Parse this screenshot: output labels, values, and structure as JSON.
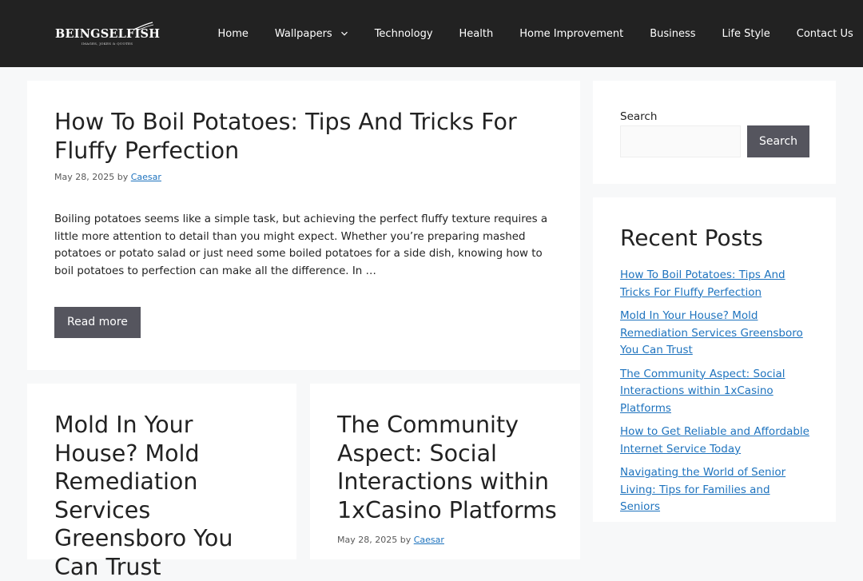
{
  "site": {
    "logo_text": "BEINGSELFISH",
    "logo_tagline": "IMAGES, JOKES & QUOTES"
  },
  "nav": {
    "items": [
      {
        "label": "Home"
      },
      {
        "label": "Wallpapers",
        "has_dropdown": true
      },
      {
        "label": "Technology"
      },
      {
        "label": "Health"
      },
      {
        "label": "Home Improvement"
      },
      {
        "label": "Business"
      },
      {
        "label": "Life Style"
      },
      {
        "label": "Contact Us"
      }
    ]
  },
  "posts": [
    {
      "title": "How To Boil Potatoes: Tips And Tricks For Fluffy Perfection",
      "date": "May 28, 2025",
      "by": "by",
      "author": "Caesar",
      "excerpt": "Boiling potatoes seems like a simple task, but achieving the perfect fluffy texture requires a little more attention to detail than you might expect. Whether you’re preparing mashed potatoes or potato salad or just need some boiled potatoes for a side dish, knowing how to boil potatoes to perfection can make all the difference. In …",
      "read_more": "Read more"
    },
    {
      "title": "Mold In Your House? Mold Remediation Services Greensboro You Can Trust"
    },
    {
      "title": "The Community Aspect: Social Interactions within 1xCasino Platforms",
      "date": "May 28, 2025",
      "by": "by",
      "author": "Caesar"
    }
  ],
  "sidebar": {
    "search": {
      "label": "Search",
      "button": "Search",
      "value": ""
    },
    "recent_posts": {
      "title": "Recent Posts",
      "items": [
        "How To Boil Potatoes: Tips And Tricks For Fluffy Perfection",
        "Mold In Your House? Mold Remediation Services Greensboro You Can Trust",
        "The Community Aspect: Social Interactions within 1xCasino Platforms",
        "How to Get Reliable and Affordable Internet Service Today",
        "Navigating the World of Senior Living: Tips for Families and Seniors"
      ]
    }
  },
  "colors": {
    "header_bg": "#222222",
    "page_bg": "#f7f8f9",
    "button_bg": "#55555e",
    "link": "#1e73be"
  },
  "icons": {
    "dropdown": "chevron-down-icon"
  }
}
